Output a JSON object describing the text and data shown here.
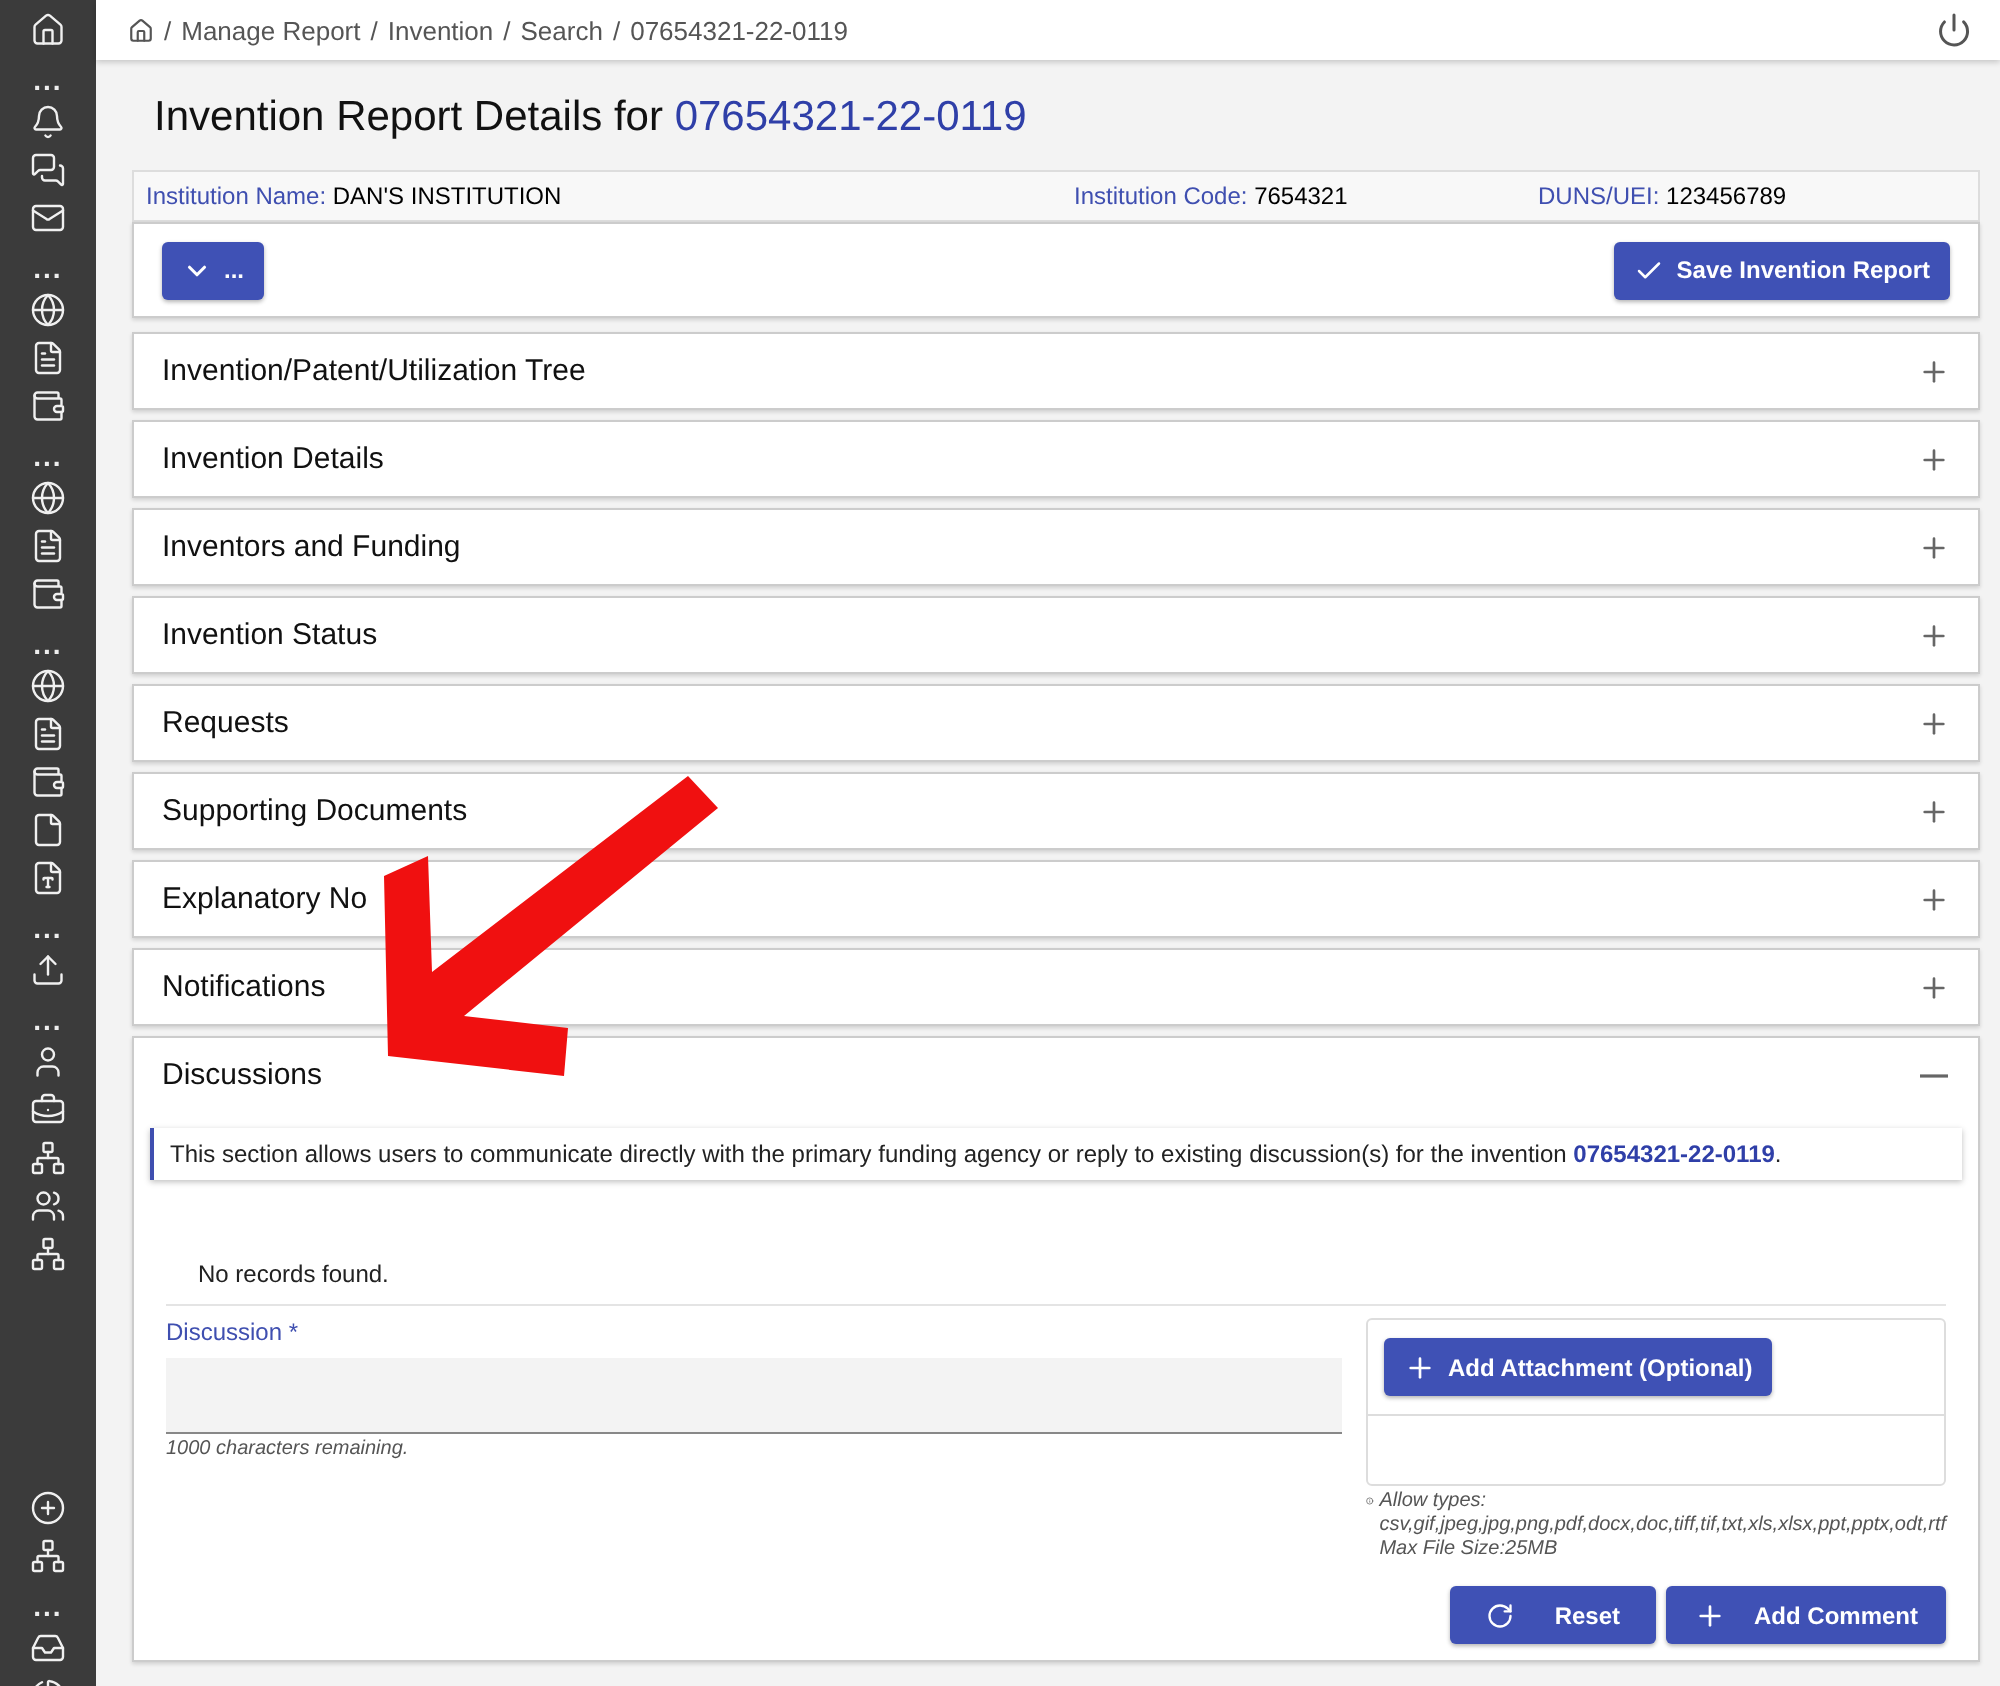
{
  "sidebar": {
    "top": [
      {
        "kind": "icon"
      },
      {
        "kind": "dots",
        "label": "..."
      },
      {
        "kind": "icon"
      },
      {
        "kind": "icon"
      },
      {
        "kind": "icon"
      },
      {
        "kind": "dots",
        "label": "..."
      },
      {
        "kind": "icon"
      },
      {
        "kind": "icon"
      },
      {
        "kind": "icon"
      },
      {
        "kind": "dots",
        "label": "..."
      },
      {
        "kind": "icon"
      },
      {
        "kind": "icon"
      },
      {
        "kind": "icon"
      },
      {
        "kind": "dots",
        "label": "..."
      },
      {
        "kind": "icon"
      },
      {
        "kind": "icon"
      },
      {
        "kind": "icon"
      },
      {
        "kind": "icon"
      },
      {
        "kind": "icon"
      },
      {
        "kind": "dots",
        "label": "..."
      },
      {
        "kind": "icon"
      },
      {
        "kind": "dots",
        "label": "..."
      },
      {
        "kind": "icon"
      },
      {
        "kind": "icon"
      },
      {
        "kind": "icon"
      },
      {
        "kind": "icon"
      },
      {
        "kind": "icon"
      }
    ],
    "bottom": [
      {
        "kind": "icon"
      },
      {
        "kind": "icon"
      },
      {
        "kind": "dots",
        "label": "..."
      },
      {
        "kind": "icon"
      },
      {
        "kind": "icon"
      }
    ]
  },
  "breadcrumb": {
    "separator": "/",
    "items": [
      "Manage Report",
      "Invention",
      "Search",
      "07654321-22-0119"
    ]
  },
  "title": {
    "text": "Invention Report Details for",
    "id": "07654321-22-0119"
  },
  "institution": [
    {
      "label": "Institution Name:",
      "value": "DAN'S INSTITUTION"
    },
    {
      "label": "Institution Code:",
      "value": "7654321"
    },
    {
      "label": "DUNS/UEI:",
      "value": "123456789"
    }
  ],
  "toolbar": {
    "menu_button": "...",
    "save_button": "Save Invention Report"
  },
  "sections": [
    {
      "title": "Invention/Patent/Utilization Tree",
      "expanded": false
    },
    {
      "title": "Invention Details",
      "expanded": false
    },
    {
      "title": "Inventors and Funding",
      "expanded": false
    },
    {
      "title": "Invention Status",
      "expanded": false
    },
    {
      "title": "Requests",
      "expanded": false
    },
    {
      "title": "Supporting Documents",
      "expanded": false
    },
    {
      "title": "Explanatory No",
      "expanded": false
    },
    {
      "title": "Notifications",
      "expanded": false
    },
    {
      "title": "Discussions",
      "expanded": true,
      "content": {
        "notice": "This section allows users to communicate directly with the primary funding agency or reply to existing discussion(s) for the invention ",
        "notice_link": "07654321-22-0119",
        "notice_end": ".",
        "empty": "No records found.",
        "field_label": "Discussion *",
        "hint": "1000 characters remaining.",
        "attach_button": "Add Attachment (Optional)",
        "allow_types": [
          "Allow types:",
          "csv,gif,jpeg,jpg,png,pdf,docx,doc,tiff,tif,txt,xls,xlsx,ppt,pptx,odt,rtf",
          "Max File Size:25MB"
        ],
        "reset_button": "Reset",
        "add_button": "Add Comment"
      }
    }
  ]
}
